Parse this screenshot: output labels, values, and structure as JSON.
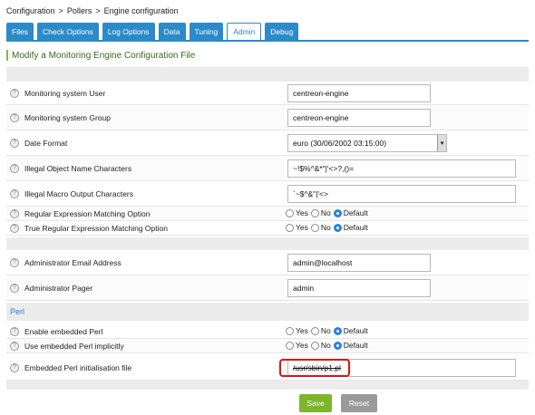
{
  "breadcrumb": [
    "Configuration",
    "Pollers",
    "Engine configuration"
  ],
  "breadcrumb_sep": ">",
  "tabs": [
    "Files",
    "Check Options",
    "Log Options",
    "Data",
    "Tuning",
    "Admin",
    "Debug"
  ],
  "active_tab": "Admin",
  "form_title": "Modify a Monitoring Engine Configuration File",
  "help_glyph": "?",
  "fields": {
    "monitoring_user": {
      "label": "Monitoring system User",
      "value": "centreon-engine"
    },
    "monitoring_group": {
      "label": "Monitoring system Group",
      "value": "centreon-engine"
    },
    "date_format": {
      "label": "Date Format",
      "value": "euro (30/06/2002 03:15:00)",
      "arrow": "▾"
    },
    "illegal_object_chars": {
      "label": "Illegal Object Name Characters",
      "value": "~!$%^&*\"|'<>?,()="
    },
    "illegal_macro_chars": {
      "label": "Illegal Macro Output Characters",
      "value": "`~$^&\"|'<>"
    },
    "regex_matching": {
      "label": "Regular Expression Matching Option",
      "options": [
        "Yes",
        "No",
        "Default"
      ],
      "selected": "Default"
    },
    "true_regex_matching": {
      "label": "True Regular Expression Matching Option",
      "options": [
        "Yes",
        "No",
        "Default"
      ],
      "selected": "Default"
    },
    "admin_email": {
      "label": "Administrator Email Address",
      "value": "admin@localhost"
    },
    "admin_pager": {
      "label": "Administrator Pager",
      "value": "admin"
    },
    "enable_embedded_perl": {
      "label": "Enable embedded Perl",
      "options": [
        "Yes",
        "No",
        "Default"
      ],
      "selected": "Default"
    },
    "use_embedded_perl": {
      "label": "Use embedded Perl implicitly",
      "options": [
        "Yes",
        "No",
        "Default"
      ],
      "selected": "Default"
    },
    "embedded_perl_file": {
      "label": "Embedded Perl initialisation file",
      "value": "/usr/sbin/p1.pl"
    }
  },
  "perl_section_title": "Perl",
  "buttons": {
    "save": "Save",
    "reset": "Reset"
  },
  "colors": {
    "tab_bg": "#2c8ac9",
    "title_green": "#3c6a18",
    "save_bg": "#7db52b",
    "reset_bg": "#9a9a9a",
    "radio_on": "#2c82d8",
    "highlight": "#e31010"
  }
}
